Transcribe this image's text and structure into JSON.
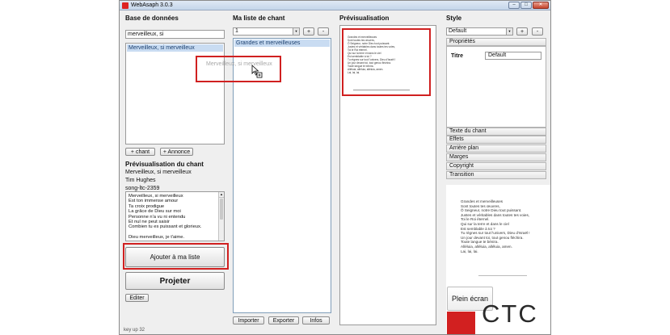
{
  "window": {
    "title": "WebAsaph 3.0.3",
    "buttons": [
      "–",
      "□",
      "✕"
    ]
  },
  "database": {
    "title": "Base de données",
    "search_value": "merveilleux, si",
    "results": [
      "Merveilleux, si merveilleux"
    ],
    "drag_ghost_text": "Merveilleux, si merveilleux",
    "add_song_button": "+ chant",
    "add_announce_button": "+ Annonce"
  },
  "song_preview": {
    "title": "Prévisualisation du chant",
    "song_title": "Merveilleux, si merveilleux",
    "author": "Tim Hughes",
    "id": "song-ltc-2359",
    "lyrics": [
      "Merveilleux, si merveilleux",
      "Est ton immense amour",
      "Ta croix prodigue",
      "La grâce de Dieu sur moi",
      "Personne n'a vu ni entendu",
      "Et nul ne peut saisir",
      "Combien tu es puissant et glorieux.",
      "",
      "Dieu merveilleux, je t'aime."
    ],
    "add_to_list_button": "Ajouter à ma liste",
    "project_button": "Projeter",
    "edit_button": "Editer"
  },
  "my_list": {
    "title": "Ma liste de chant",
    "selected_list": "1",
    "add_button": "+",
    "remove_button": "-",
    "items": [
      "Grandes et merveilleuses"
    ],
    "import_button": "Importer",
    "export_button": "Exporter",
    "info_button": "Infos"
  },
  "preview": {
    "title": "Prévisualisation",
    "thumb_lines": [
      "Grandes et merveilleuses",
      "Sont toutes tes œuvres,",
      "Ô Seigneur, notre Dieu tout puissant.",
      "Justes et véritables dans toutes tes voies,",
      "Toi le Roi éternel.",
      "Qui sur la terre et dans le ciel",
      "Est semblable à toi ?",
      "Tu règnes sur tout l'univers, Dieu d'Israël !",
      "Un jour devant toi, tout genou fléchira.",
      "Toute langue te bénira.",
      "Alléluia, alléluia, alléluia, amen.",
      "Lai, lai, lai."
    ]
  },
  "style": {
    "title": "Style",
    "selected_style": "Default",
    "add_button": "+",
    "remove_button": "-",
    "properties_header": "Propriétés",
    "title_label": "Titre",
    "title_value": "Default",
    "sections": [
      "Texte du chant",
      "Effets",
      "Arrière plan",
      "Marges",
      "Copyright",
      "Transition"
    ],
    "preview_lines": [
      "Grandes et merveilleuses",
      "Sont toutes tes œuvres,",
      "Ô Seigneur, notre Dieu tout puissant.",
      "Justes et véritables dans toutes tes voies,",
      "Toi le Roi éternel.",
      "Qui sur la terre et dans le ciel",
      "Est semblable à toi ?",
      "Tu règnes sur tout l'univers, Dieu d'Israël !",
      "Un jour devant toi, tout genou fléchira.",
      "Toute langue te bénira.",
      "Alléluia, alléluia, alléluia, amen.",
      "Lai, lai, lai."
    ],
    "fullscreen_button": "Plein écran",
    "logo_text": "CTC"
  },
  "statusbar": {
    "text": "key up 32"
  },
  "colors": {
    "highlight": "#d02020",
    "selection": "#c9dcf2",
    "logo": "#d22020"
  }
}
